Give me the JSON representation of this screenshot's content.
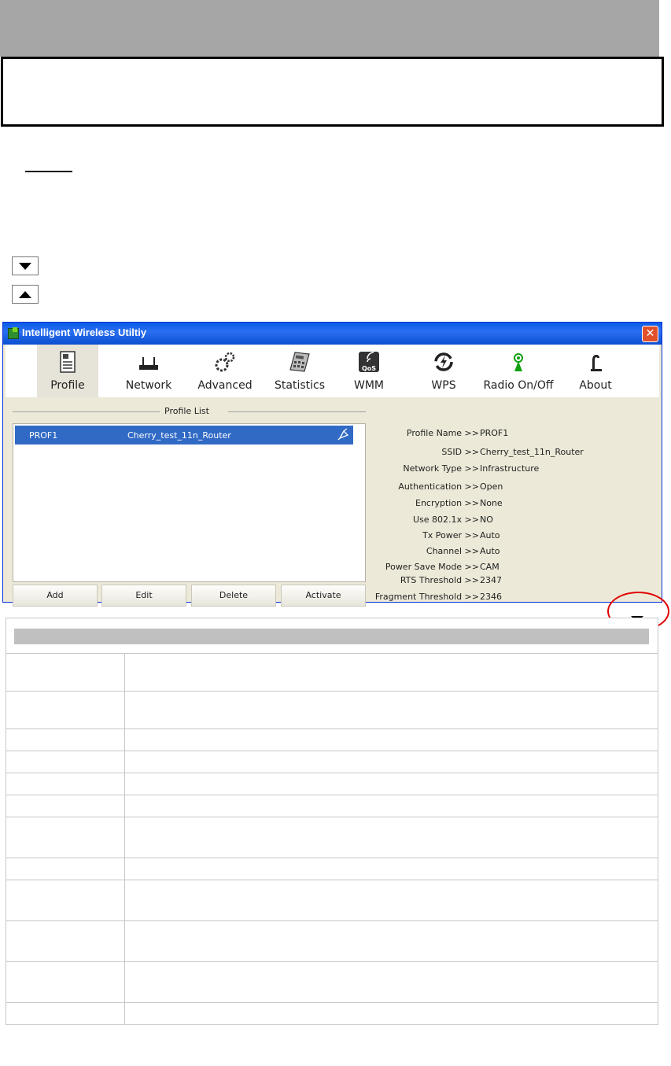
{
  "window": {
    "title": "Intelligent Wireless Utiltiy",
    "close_glyph": "✕"
  },
  "toolbar": {
    "items": [
      {
        "label": "Profile",
        "icon": "profile-icon",
        "selected": true
      },
      {
        "label": "Network",
        "icon": "network-icon",
        "selected": false
      },
      {
        "label": "Advanced",
        "icon": "advanced-icon",
        "selected": false
      },
      {
        "label": "Statistics",
        "icon": "statistics-icon",
        "selected": false
      },
      {
        "label": "WMM",
        "icon": "wmm-icon",
        "selected": false
      },
      {
        "label": "WPS",
        "icon": "wps-icon",
        "selected": false
      },
      {
        "label": "Radio On/Off",
        "icon": "radio-icon",
        "selected": false
      },
      {
        "label": "About",
        "icon": "about-icon",
        "selected": false
      }
    ]
  },
  "profile_list": {
    "title": "Profile List",
    "rows": [
      {
        "name": "PROF1",
        "ssid": "Cherry_test_11n_Router",
        "active": true
      }
    ]
  },
  "buttons": {
    "add": "Add",
    "edit": "Edit",
    "delete": "Delete",
    "activate": "Activate"
  },
  "details": [
    {
      "label": "Profile Name >> ",
      "value": "PROF1"
    },
    {
      "label": "SSID >> ",
      "value": "Cherry_test_11n_Router"
    },
    {
      "label": "Network Type >> ",
      "value": "Infrastructure"
    },
    {
      "label": "Authentication >> ",
      "value": "Open"
    },
    {
      "label": "Encryption >> ",
      "value": "None"
    },
    {
      "label": "Use 802.1x >> ",
      "value": "NO"
    },
    {
      "label": "Tx Power >> ",
      "value": "Auto"
    },
    {
      "label": "Channel >> ",
      "value": "Auto"
    },
    {
      "label": "Power Save Mode >> ",
      "value": "CAM"
    },
    {
      "label": "RTS Threshold >> ",
      "value": "2347"
    },
    {
      "label": "Fragment Threshold >> ",
      "value": "2346"
    }
  ],
  "colors": {
    "selection": "#316ac5",
    "window_bg": "#ece9d8",
    "highlight_circle": "#e00000"
  }
}
